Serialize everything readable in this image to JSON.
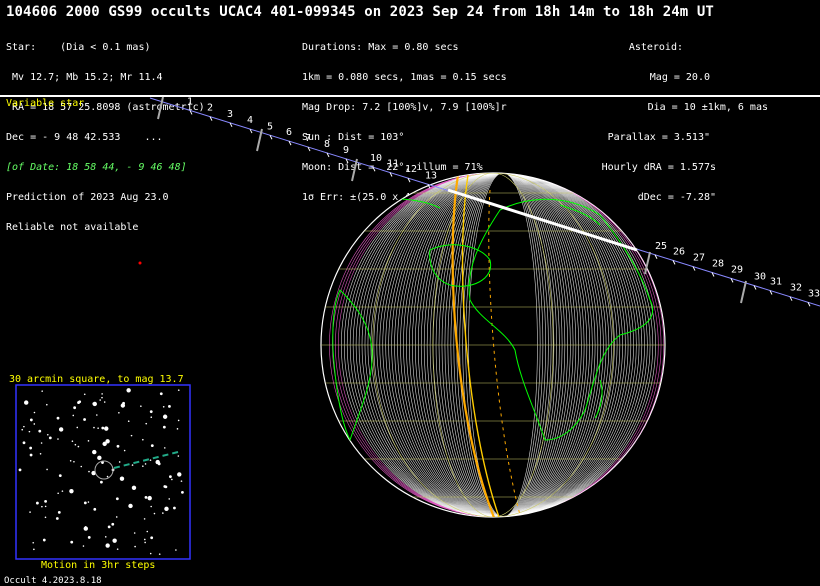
{
  "title": "104606 2000 GS99 occults UCAC4 401-099345 on 2023 Sep 24 from 18h 14m to 18h 24m UT",
  "star": {
    "header": "Star:    (Dia < 0.1 mas)",
    "mags": " Mv 12.7; Mb 15.2; Mr 11.4",
    "ra": " RA = 18 57 25.8098 (astrometric)",
    "dec": "Dec = - 9 48 42.533    ...",
    "of_date": "[of Date: 18 58 44, - 9 46 48]",
    "prediction": "Prediction of 2023 Aug 23.0",
    "reliable": "Reliable not available"
  },
  "event": {
    "durations": "Durations: Max = 0.80 secs",
    "scale": "1km = 0.080 secs, 1mas = 0.15 secs",
    "mag_drop": "Mag Drop: 7.2 [100%]v, 7.9 [100%]r",
    "sun": "Sun : Dist = 103°",
    "moon": "Moon: Dist =  22°, illum = 71%",
    "error": "1σ Err: ±(25.0 x 4.0) mas in PA 80°"
  },
  "asteroid": {
    "header": "Asteroid:",
    "mag": "Mag = 20.0",
    "dia": "Dia = 10 ±1km, 6 mas",
    "parallax": "Parallax = 3.513\"",
    "hourly_dra": "Hourly dRA = 1.577s",
    "ddec": "dDec = -7.28\""
  },
  "variable_star": "Variable star",
  "path_ticks_left": [
    "1",
    "2",
    "3",
    "4",
    "5",
    "6",
    "7",
    "8",
    "9",
    "10",
    "11",
    "12",
    "13"
  ],
  "path_ticks_right": [
    "25",
    "26",
    "27",
    "28",
    "29",
    "30",
    "31",
    "32",
    "33"
  ],
  "finder": {
    "title": "30 arcmin square, to mag 13.7",
    "motion": "Motion in 3hr steps"
  },
  "footer": "Occult 4.2023.8.18",
  "colors": {
    "text": "#ffffff",
    "highlight": "#ffff00",
    "coastline": "#00ff00",
    "path_line": "#ff8800",
    "grid": "#cccc66",
    "finder_border": "#3333ff"
  }
}
